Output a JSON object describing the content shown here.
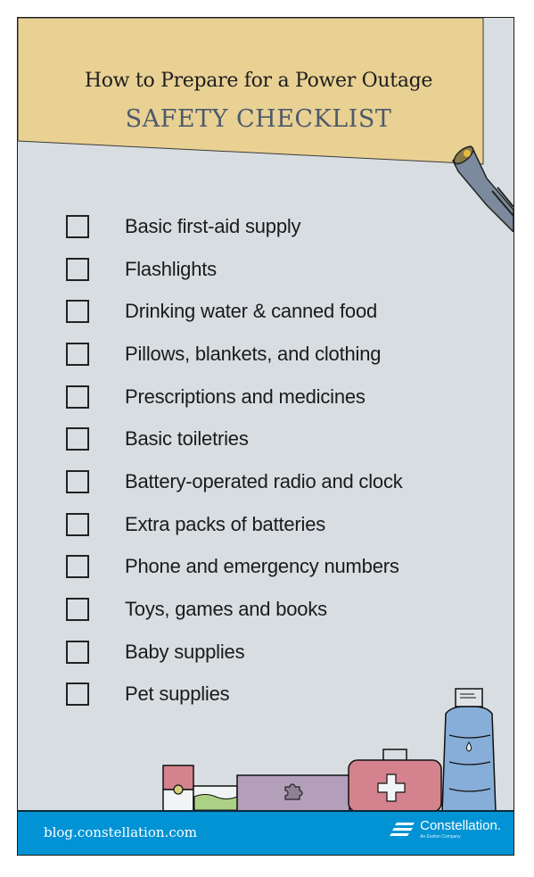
{
  "header": {
    "subtitle": "How to Prepare for a Power Outage",
    "title": "SAFETY CHECKLIST"
  },
  "checklist": [
    {
      "label": "Basic first-aid supply",
      "checked": false
    },
    {
      "label": "Flashlights",
      "checked": false
    },
    {
      "label": "Drinking water & canned food",
      "checked": false
    },
    {
      "label": "Pillows, blankets, and clothing",
      "checked": false
    },
    {
      "label": "Prescriptions and medicines",
      "checked": false
    },
    {
      "label": "Basic toiletries",
      "checked": false
    },
    {
      "label": "Battery-operated radio and clock",
      "checked": false
    },
    {
      "label": "Extra packs of batteries",
      "checked": false
    },
    {
      "label": "Phone and emergency numbers",
      "checked": false
    },
    {
      "label": "Toys, games and books",
      "checked": false
    },
    {
      "label": "Baby supplies",
      "checked": false
    },
    {
      "label": "Pet supplies",
      "checked": false
    }
  ],
  "footer": {
    "url": "blog.constellation.com",
    "brand": "Constellation.",
    "brand_tagline": "An Exelon Company"
  },
  "icons": {
    "flashlight": "flashlight-icon",
    "first_aid_kit": "first-aid-kit-icon",
    "water_jug": "water-jug-icon",
    "puzzle_box": "puzzle-box-icon",
    "pill_bottle": "pill-bottle-icon",
    "food_tray": "food-tray-icon",
    "logo": "constellation-logo-icon"
  },
  "colors": {
    "background": "#d8dde1",
    "banner": "#e9d194",
    "title_accent": "#4d5a6b",
    "footer": "#0193d4",
    "kit_red": "#d4838e",
    "jug_blue": "#87aed8",
    "box_purple": "#b39fba"
  }
}
